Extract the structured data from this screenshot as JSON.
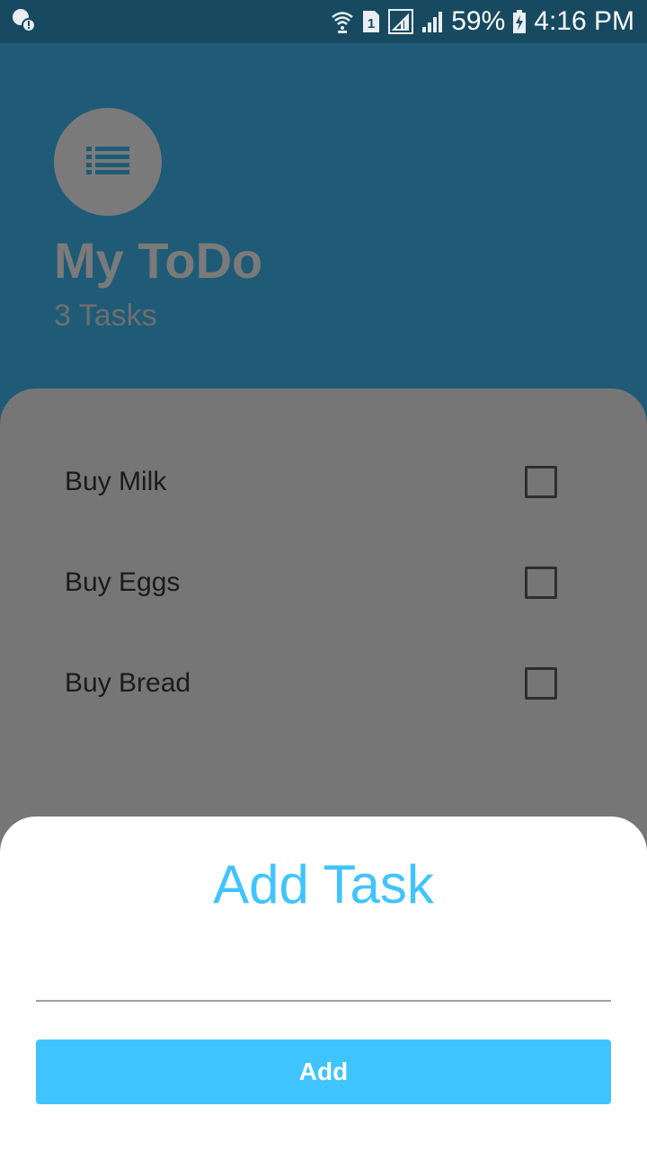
{
  "status_bar": {
    "battery_percent": "59%",
    "time": "4:16 PM",
    "sim_slot": "1",
    "icons": [
      "notification-icon",
      "wifi-icon",
      "sim-icon",
      "signal-icon",
      "signal-icon",
      "battery-icon"
    ]
  },
  "header": {
    "icon": "list-icon",
    "title": "My ToDo",
    "task_count": "3 Tasks"
  },
  "tasks": [
    {
      "label": "Buy Milk",
      "checked": false
    },
    {
      "label": "Buy Eggs",
      "checked": false
    },
    {
      "label": "Buy Bread",
      "checked": false
    }
  ],
  "add_sheet": {
    "title": "Add Task",
    "input_value": "",
    "button_label": "Add"
  },
  "colors": {
    "header_bg": "#1f5b76",
    "status_bar_bg": "#174a61",
    "panel_bg": "#767676",
    "accent": "#40c4ff",
    "sheet_bg": "#ffffff"
  }
}
